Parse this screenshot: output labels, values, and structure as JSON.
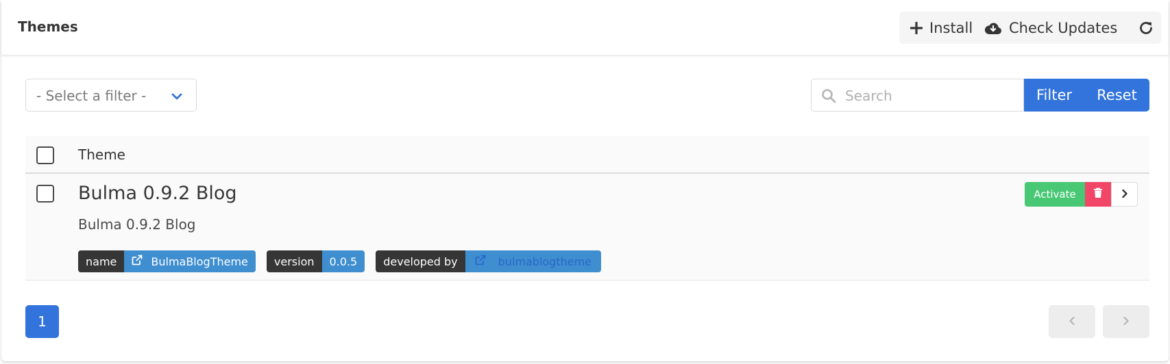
{
  "header": {
    "title": "Themes",
    "install_label": "Install",
    "check_updates_label": "Check Updates"
  },
  "filter": {
    "selected": "- Select a filter -"
  },
  "search": {
    "placeholder": "Search",
    "value": "",
    "filter_label": "Filter",
    "reset_label": "Reset"
  },
  "table": {
    "column_header": "Theme",
    "rows": [
      {
        "title": "Bulma 0.9.2 Blog",
        "description": "Bulma 0.9.2 Blog",
        "tags": [
          {
            "key": "name",
            "value": "BulmaBlogTheme"
          },
          {
            "key": "version",
            "value": "0.0.5"
          },
          {
            "key": "developed by",
            "value": "bulmablogtheme"
          }
        ],
        "activate_label": "Activate"
      }
    ]
  },
  "pagination": {
    "current_page": "1"
  },
  "colors": {
    "primary": "#3273dc",
    "success": "#48c774",
    "danger": "#f14668",
    "info": "#3e8ed0",
    "dark": "#363636"
  }
}
